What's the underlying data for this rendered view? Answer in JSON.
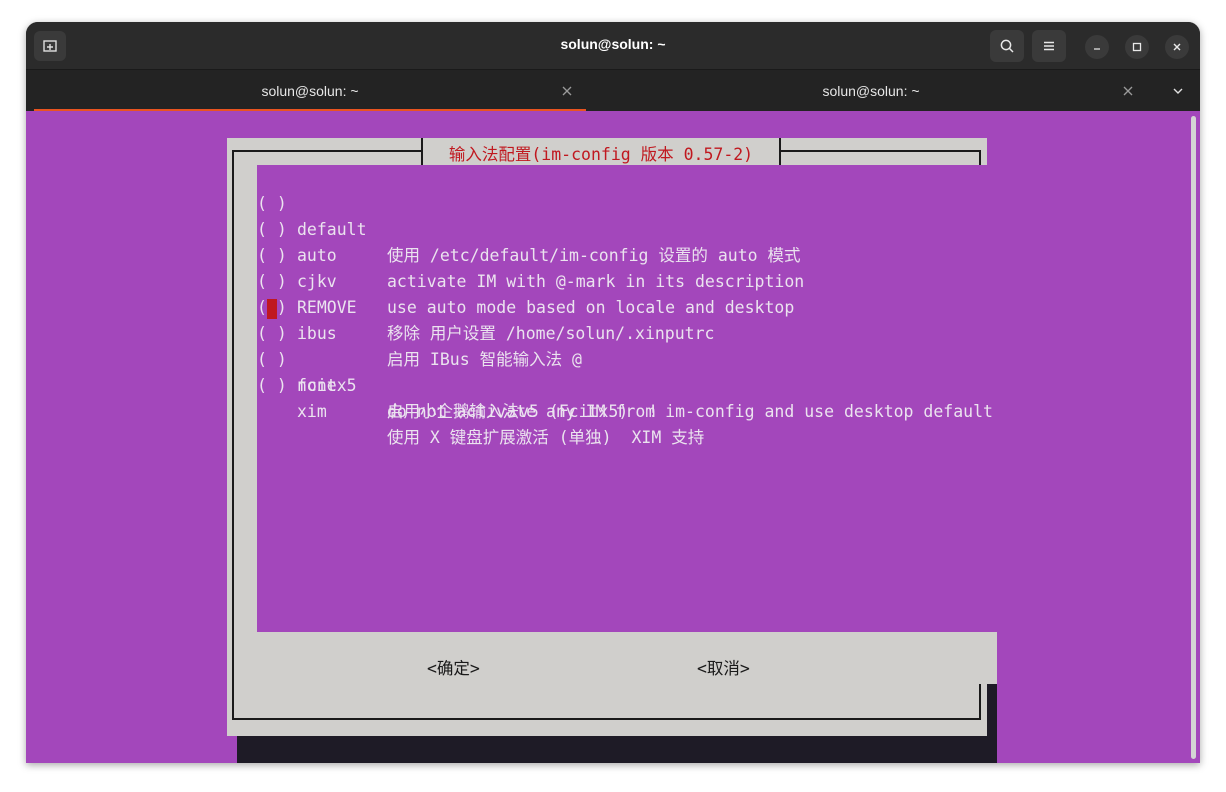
{
  "window": {
    "title": "solun@solun: ~"
  },
  "tabs": [
    {
      "label": "solun@solun: ~",
      "active": true
    },
    {
      "label": "solun@solun: ~",
      "active": false
    }
  ],
  "icons": {
    "new_tab": "new-tab-icon",
    "search": "search-icon",
    "menu": "hamburger-menu-icon",
    "minimize": "minimize-icon",
    "maximize": "maximize-icon",
    "close": "close-icon",
    "tab_close": "tab-close-icon",
    "tabs_dropdown": "chevron-down-icon"
  },
  "colors": {
    "terminal_bg": "#a347bb",
    "dialog_bg": "#d0cfcc",
    "title_red": "#c0181f",
    "tab_accent": "#e95420"
  },
  "dialog": {
    "title": "输入法配置(im-config 版本 0.57-2)",
    "items": [
      {
        "mark": "( )",
        "name": "default",
        "description": "使用 /etc/default/im-config 设置的 auto 模式"
      },
      {
        "mark": "( )",
        "name": "auto",
        "description": "activate IM with @-mark in its description"
      },
      {
        "mark": "( )",
        "name": "cjkv",
        "description": "use auto mode based on locale and desktop"
      },
      {
        "mark": "( )",
        "name": "REMOVE",
        "description": "移除 用户设置 /home/solun/.xinputrc"
      },
      {
        "mark": "( )",
        "name": "ibus",
        "description": "启用 IBus 智能输入法 @"
      },
      {
        "mark": "( )",
        "name": "fcitx5",
        "description": "启用小企鹅输入法v5 (Fcitx5)  !",
        "cursor": true
      },
      {
        "mark": "( )",
        "name": "none",
        "description": "do not activate any IM from im-config and use desktop default"
      },
      {
        "mark": "( )",
        "name": "xim",
        "description": "使用 X 键盘扩展激活 (单独)  XIM 支持"
      }
    ],
    "ok_button": "<确定>",
    "cancel_button": "<取消>"
  }
}
